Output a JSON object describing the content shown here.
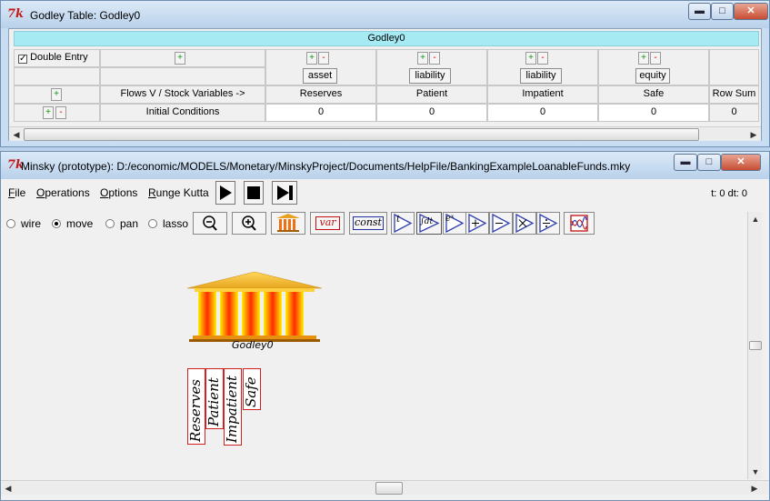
{
  "godley_window": {
    "title": "Godley Table: Godley0",
    "table_title": "Godley0",
    "double_entry_label": "Double Entry",
    "double_entry_checked": true,
    "plus": "+",
    "minus": "-",
    "column_types": [
      "asset",
      "liability",
      "liability",
      "equity"
    ],
    "row_header_label": "Flows V / Stock Variables ->",
    "stock_variables": [
      "Reserves",
      "Patient",
      "Impatient",
      "Safe"
    ],
    "row_sum_label": "Row Sum",
    "initial_conditions_label": "Initial Conditions",
    "initial_values": [
      "0",
      "0",
      "0",
      "0"
    ],
    "row_sum_value": "0"
  },
  "minsky_window": {
    "title": "Minsky (prototype): D:/economic/MODELS/Monetary/MinskyProject/Documents/HelpFile/BankingExampleLoanableFunds.mky",
    "menus": [
      {
        "label": "File",
        "accel": "F",
        "rest": "ile"
      },
      {
        "label": "Operations",
        "accel": "O",
        "rest": "perations"
      },
      {
        "label": "Options",
        "accel": "O",
        "rest": "ptions"
      },
      {
        "label": "Runge Kutta",
        "accel": "R",
        "rest": "unge Kutta"
      }
    ],
    "status": "t: 0 dt: 0",
    "modes": [
      "wire",
      "move",
      "pan",
      "lasso"
    ],
    "selected_mode": "move",
    "tools": {
      "var": "var",
      "const": "const",
      "time": "t",
      "integrate": "∫dt",
      "exp": "eˣ"
    },
    "godley_icon_label": "Godley0",
    "stock_variables": [
      "Reserves",
      "Patient",
      "Impatient",
      "Safe"
    ]
  },
  "icons": [
    "tk-feather-icon",
    "minimize-icon",
    "maximize-icon",
    "close-icon",
    "play-icon",
    "stop-icon",
    "step-icon",
    "zoom-out-icon",
    "zoom-in-icon",
    "bank-icon",
    "plus-icon",
    "minus-icon",
    "multiply-icon",
    "divide-icon",
    "plot-icon"
  ],
  "colors": {
    "accent": "#c21818",
    "table_title_bar": "#a6eaf4",
    "add_green": "#0a9a0a",
    "remove_red": "#cc0000"
  }
}
